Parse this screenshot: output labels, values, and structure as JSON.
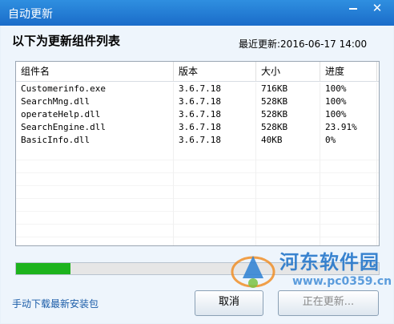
{
  "window": {
    "title": "自动更新",
    "minimize_icon": "minimize-icon",
    "close_icon": "close-icon",
    "close_glyph": "✕"
  },
  "header": {
    "heading": "以下为更新组件列表",
    "last_update": "最近更新:2016-06-17 14:00"
  },
  "table": {
    "columns": [
      "组件名",
      "版本",
      "大小",
      "进度"
    ],
    "rows": [
      [
        "Customerinfo.exe",
        "3.6.7.18",
        "716KB",
        "100%"
      ],
      [
        "SearchMng.dll",
        "3.6.7.18",
        "528KB",
        "100%"
      ],
      [
        "operateHelp.dll",
        "3.6.7.18",
        "528KB",
        "100%"
      ],
      [
        "SearchEngine.dll",
        "3.6.7.18",
        "528KB",
        "23.91%"
      ],
      [
        "BasicInfo.dll",
        "3.6.7.18",
        "40KB",
        "0%"
      ]
    ]
  },
  "progress": {
    "fraction": 0.15,
    "color": "#1db31d"
  },
  "footer": {
    "manual_link": "手动下载最新安装包",
    "cancel_label": "取消",
    "updating_label": "正在更新..."
  },
  "watermark": {
    "site_name": "河东软件园",
    "url": "www.pc0359.cn"
  }
}
